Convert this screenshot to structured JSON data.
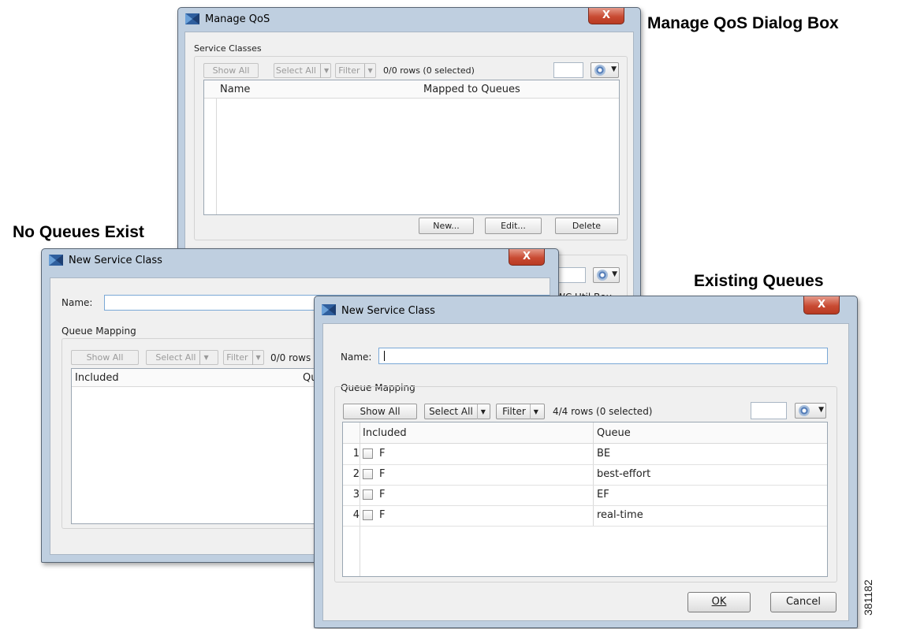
{
  "captions": {
    "manage": "Manage QoS Dialog Box",
    "no_queues": "No Queues Exist",
    "existing": "Existing Queues",
    "figure_id": "381182"
  },
  "manage_qos": {
    "title": "Manage QoS",
    "close": "X",
    "section": "Service Classes",
    "toolbar": {
      "show_all": "Show All",
      "select_all": "Select All",
      "filter": "Filter",
      "dropdown_glyph": "▼",
      "rows": "0/0 rows (0 selected)"
    },
    "columns": {
      "name": "Name",
      "mapped": "Mapped to Queues"
    },
    "buttons": {
      "new": "New...",
      "edit": "Edit...",
      "delete": "Delete"
    },
    "partial_text": "WC Util Bou"
  },
  "no_queues_dialog": {
    "title": "New Service Class",
    "close": "X",
    "name_label": "Name:",
    "section": "Queue Mapping",
    "toolbar": {
      "show_all": "Show All",
      "select_all": "Select All",
      "filter": "Filter",
      "rows": "0/0 rows ("
    },
    "columns": {
      "included": "Included",
      "queue": "Qu"
    }
  },
  "existing_dialog": {
    "title": "New Service Class",
    "close": "X",
    "name_label": "Name:",
    "name_value": "",
    "section": "Queue Mapping",
    "toolbar": {
      "show_all": "Show All",
      "select_all": "Select All",
      "filter": "Filter",
      "rows": "4/4 rows (0 selected)"
    },
    "columns": {
      "included": "Included",
      "queue": "Queue"
    },
    "rows": [
      {
        "num": "1",
        "included": "F",
        "queue": "BE"
      },
      {
        "num": "2",
        "included": "F",
        "queue": "best-effort"
      },
      {
        "num": "3",
        "included": "F",
        "queue": "EF"
      },
      {
        "num": "4",
        "included": "F",
        "queue": "real-time"
      }
    ],
    "buttons": {
      "ok": "OK",
      "cancel": "Cancel"
    }
  },
  "icons": {
    "gear": "gear-icon",
    "logo": "cisco-logo-icon"
  }
}
